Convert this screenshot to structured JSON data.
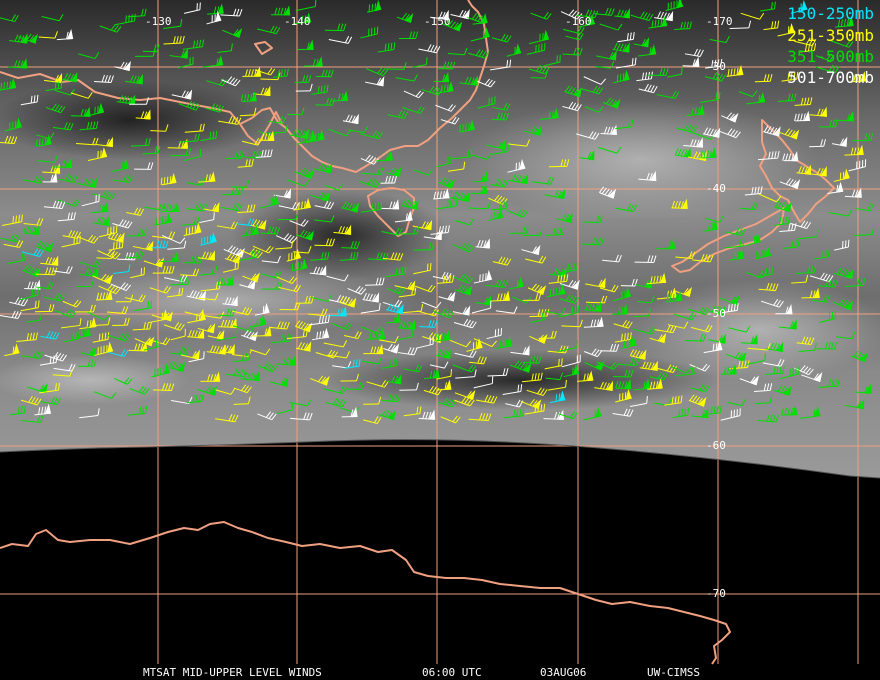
{
  "colors": {
    "ocean": "#000000",
    "coast": "#f0a080",
    "grid": "#f0a080",
    "band_150_250": "#00e8ff",
    "band_251_350": "#ffff00",
    "band_351_500": "#00e000",
    "band_501_700": "#ffffff"
  },
  "legend": [
    {
      "label": "150-250mb",
      "color": "#00e8ff"
    },
    {
      "label": "251-350mb",
      "color": "#ffff00"
    },
    {
      "label": "351-500mb",
      "color": "#00e000"
    },
    {
      "label": "501-700mb",
      "color": "#ffffff"
    }
  ],
  "grid": {
    "longitude_labels": [
      "-130",
      "-140",
      "-150",
      "-160",
      "-170"
    ],
    "latitude_labels": [
      "-30",
      "-40",
      "-50",
      "-60",
      "-70"
    ]
  },
  "footer": {
    "product": "MTSAT MID-UPPER LEVEL WINDS",
    "time": "06:00 UTC",
    "date": "03AUG06",
    "source": "UW-CIMSS"
  },
  "icons": [
    "wind-barb-icon"
  ]
}
